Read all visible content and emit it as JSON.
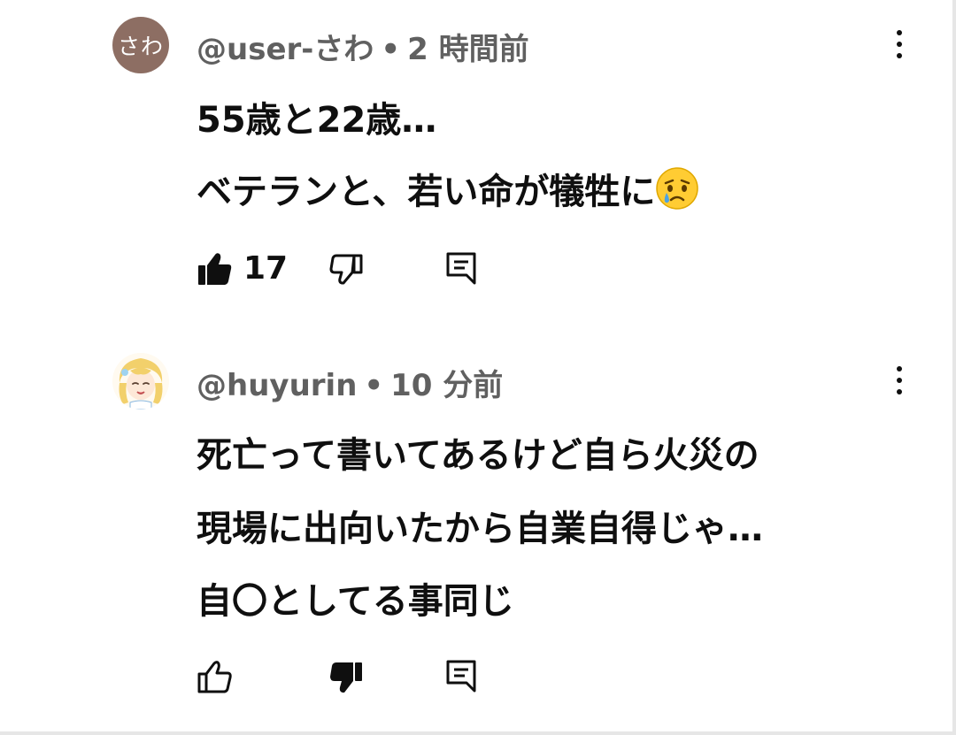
{
  "comments": [
    {
      "avatar_text": "さわ",
      "author": "@user-さわ",
      "separator": "•",
      "time": "2 時間前",
      "lines": [
        "55歳と22歳…",
        "ベテランと、若い命が犠牲に"
      ],
      "emoji": "crying-face-emoji",
      "like_count": "17",
      "liked": true,
      "disliked": false
    },
    {
      "author": "@huyurin",
      "separator": "•",
      "time": "10 分前",
      "lines": [
        "死亡って書いてあるけど自ら火災の",
        "現場に出向いたから自業自得じゃ…",
        "自〇としてる事同じ"
      ],
      "like_count": "",
      "liked": false,
      "disliked": true
    }
  ],
  "icons": {
    "like": "thumbs-up-icon",
    "dislike": "thumbs-down-icon",
    "reply": "reply-comment-icon",
    "more": "more-vertical-icon"
  },
  "colors": {
    "avatar_bg": "#8d6e63",
    "meta_text": "#606060",
    "body_text": "#0f0f0f"
  }
}
